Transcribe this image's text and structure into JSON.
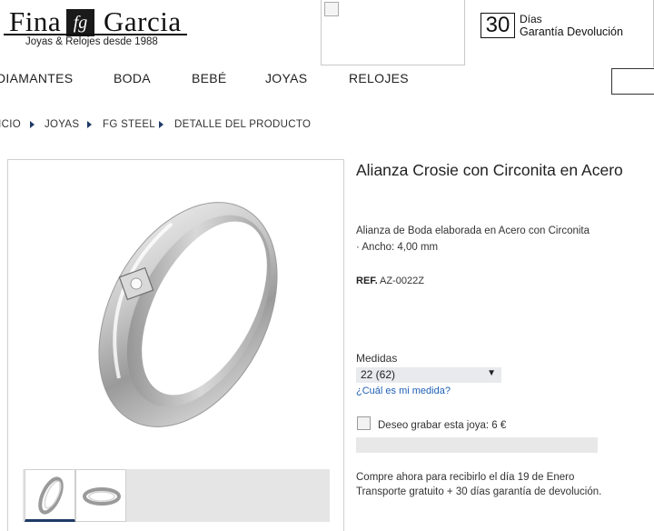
{
  "header": {
    "logo_left": "Fina",
    "logo_mark": "fg",
    "logo_right": "Garcia",
    "logo_tagline": "Joyas & Relojes desde 1988",
    "guarantee_number": "30",
    "guarantee_line1": "Días",
    "guarantee_line2": "Garantía Devolución"
  },
  "nav": {
    "items": [
      "DIAMANTES",
      "BODA",
      "BEBÉ",
      "JOYAS",
      "RELOJES"
    ]
  },
  "breadcrumb": [
    "INICIO",
    "JOYAS",
    "FG STEEL",
    "DETALLE DEL PRODUCTO"
  ],
  "product": {
    "title": "Alianza Crosie con Circonita en Acero",
    "description": "Alianza de Boda elaborada en Acero con Circonita",
    "width": "· Ancho: 4,00 mm",
    "ref_label": "REF.",
    "ref_value": "AZ-0022Z",
    "sizes_label": "Medidas",
    "size_selected": "22 (62)",
    "size_help_link": "¿Cuál es mi medida?",
    "engrave_label": "Deseo grabar esta joya: 6 €",
    "shipping_line1": "Compre ahora para recibirlo el día 19 de Enero",
    "shipping_line2": "Transporte gratuito + 30 días garantía de devolución."
  },
  "colors": {
    "accent": "#1f3a66",
    "link": "#1f5fb5"
  },
  "icons": {
    "broken_image": "broken-image-icon",
    "crumb_separator": "triangle-right-icon",
    "select_caret": "caret-down-icon"
  }
}
